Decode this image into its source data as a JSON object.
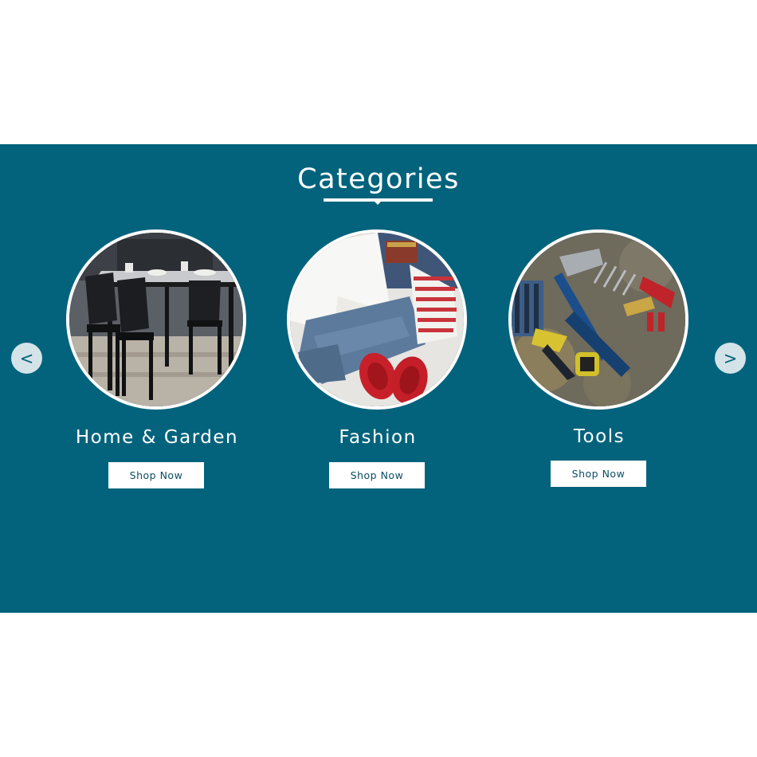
{
  "section": {
    "heading": "Categories",
    "background_color": "#03637c",
    "accent_color": "#ffffff"
  },
  "carousel": {
    "prev_label": "<",
    "next_label": ">",
    "prev_icon": "chevron-left-icon",
    "next_icon": "chevron-right-icon"
  },
  "categories": [
    {
      "title": "Home & Garden",
      "button_label": "Shop Now",
      "image": "dining-table-chairs-photo"
    },
    {
      "title": "Fashion",
      "button_label": "Shop Now",
      "image": "clothing-flatlay-photo"
    },
    {
      "title": "Tools",
      "button_label": "Shop Now",
      "image": "hand-tools-photo"
    }
  ]
}
